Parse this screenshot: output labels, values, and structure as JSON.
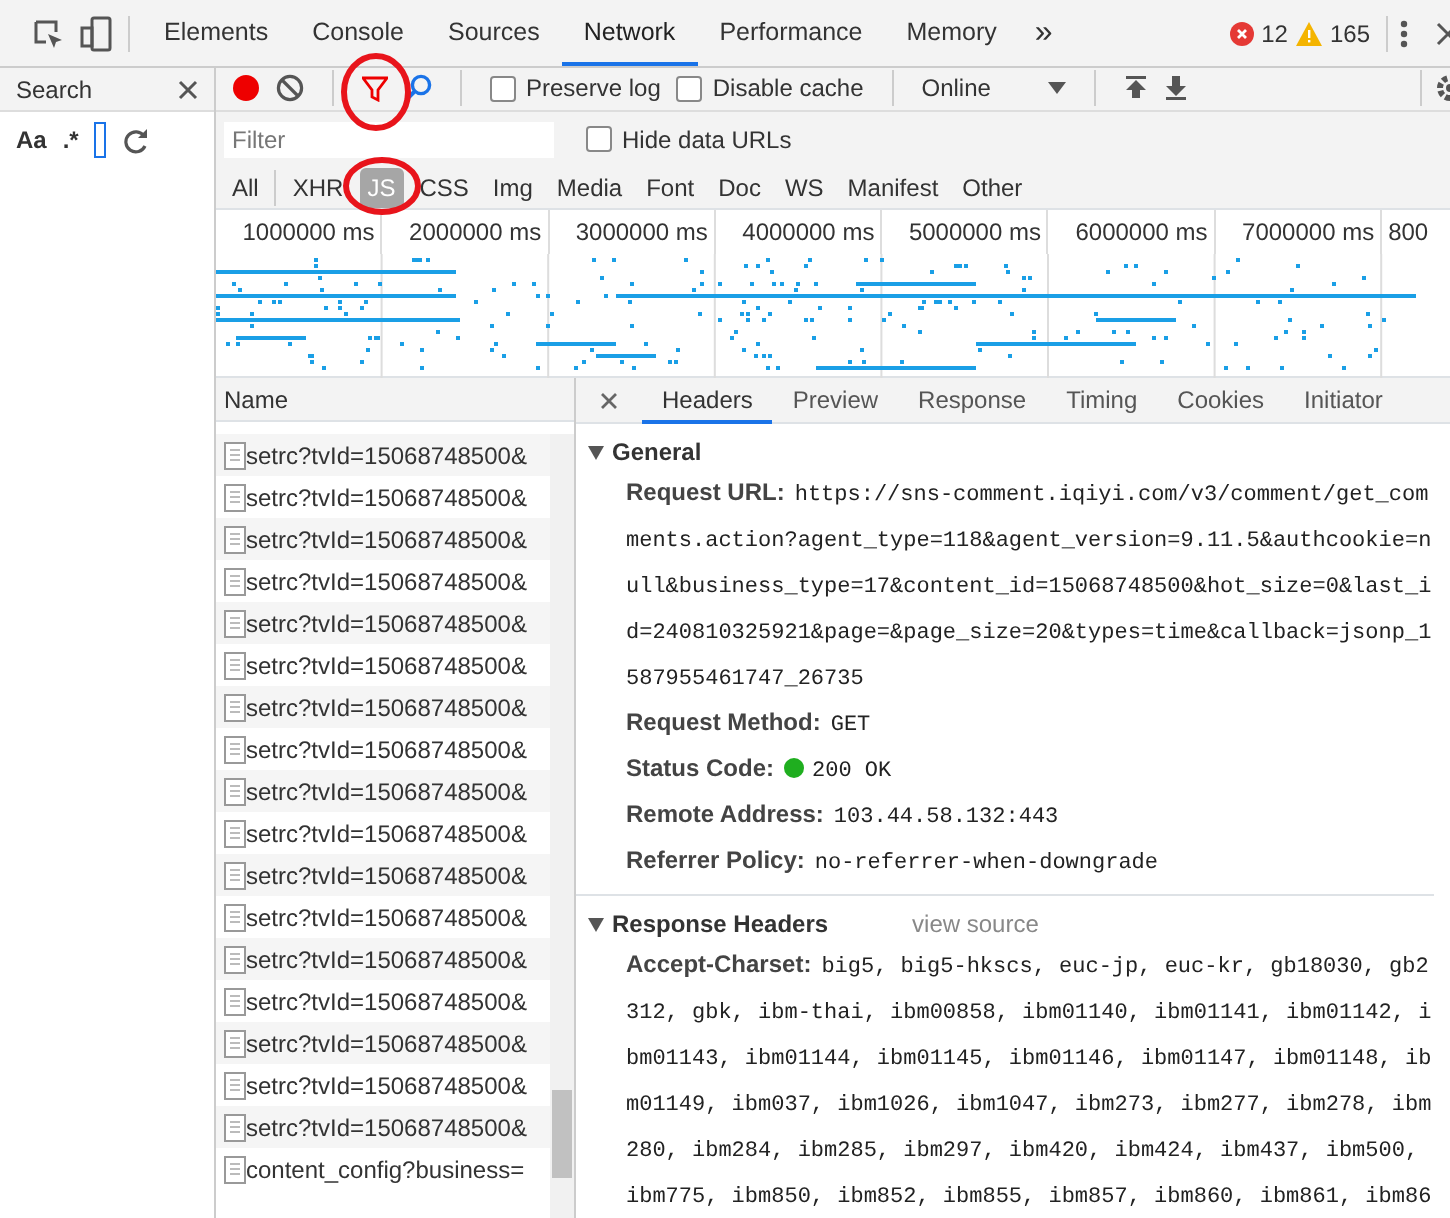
{
  "top_tabs": [
    {
      "label": "Elements",
      "selected": false
    },
    {
      "label": "Console",
      "selected": false
    },
    {
      "label": "Sources",
      "selected": false
    },
    {
      "label": "Network",
      "selected": true
    },
    {
      "label": "Performance",
      "selected": false
    },
    {
      "label": "Memory",
      "selected": false
    }
  ],
  "more_tabs": "»",
  "errors": "12",
  "warnings": "165",
  "search_panel": {
    "title": "Search",
    "case_toggle": "Aa",
    "regex_toggle": ".*"
  },
  "toolbar": {
    "recording": true,
    "filter_circled": true,
    "preserve_log": {
      "label": "Preserve log",
      "checked": false
    },
    "disable_cache": {
      "label": "Disable cache",
      "checked": false
    },
    "throttle": "Online"
  },
  "filter": {
    "placeholder": "Filter",
    "hide_data_urls": {
      "label": "Hide data URLs",
      "checked": false
    }
  },
  "types": [
    {
      "label": "All",
      "selected": false,
      "circled": false
    },
    {
      "label": "XHR",
      "selected": false,
      "circled": false
    },
    {
      "label": "JS",
      "selected": true,
      "circled": true
    },
    {
      "label": "CSS",
      "selected": false,
      "circled": false
    },
    {
      "label": "Img",
      "selected": false,
      "circled": false
    },
    {
      "label": "Media",
      "selected": false,
      "circled": false
    },
    {
      "label": "Font",
      "selected": false,
      "circled": false
    },
    {
      "label": "Doc",
      "selected": false,
      "circled": false
    },
    {
      "label": "WS",
      "selected": false,
      "circled": false
    },
    {
      "label": "Manifest",
      "selected": false,
      "circled": false
    },
    {
      "label": "Other",
      "selected": false,
      "circled": false
    }
  ],
  "timeline": {
    "ticks": [
      "1000000 ms",
      "2000000 ms",
      "3000000 ms",
      "4000000 ms",
      "5000000 ms",
      "6000000 ms",
      "7000000 ms",
      "800"
    ]
  },
  "requests": {
    "column": "Name",
    "rows": [
      {
        "name": "setrc?tvId=15068748500&"
      },
      {
        "name": "setrc?tvId=15068748500&"
      },
      {
        "name": "setrc?tvId=15068748500&"
      },
      {
        "name": "setrc?tvId=15068748500&"
      },
      {
        "name": "setrc?tvId=15068748500&"
      },
      {
        "name": "setrc?tvId=15068748500&"
      },
      {
        "name": "setrc?tvId=15068748500&"
      },
      {
        "name": "setrc?tvId=15068748500&"
      },
      {
        "name": "setrc?tvId=15068748500&"
      },
      {
        "name": "setrc?tvId=15068748500&"
      },
      {
        "name": "setrc?tvId=15068748500&"
      },
      {
        "name": "setrc?tvId=15068748500&"
      },
      {
        "name": "setrc?tvId=15068748500&"
      },
      {
        "name": "setrc?tvId=15068748500&"
      },
      {
        "name": "setrc?tvId=15068748500&"
      },
      {
        "name": "setrc?tvId=15068748500&"
      },
      {
        "name": "setrc?tvId=15068748500&"
      },
      {
        "name": "content_config?business="
      }
    ]
  },
  "details": {
    "tabs": [
      {
        "label": "Headers",
        "selected": true
      },
      {
        "label": "Preview",
        "selected": false
      },
      {
        "label": "Response",
        "selected": false
      },
      {
        "label": "Timing",
        "selected": false
      },
      {
        "label": "Cookies",
        "selected": false
      },
      {
        "label": "Initiator",
        "selected": false
      }
    ],
    "sections": [
      {
        "title": "General",
        "expanded": true,
        "fields": [
          {
            "kind": "text",
            "label": "Request URL:",
            "value": "https://sns-comment.iqiyi.com/v3/comment/get_comments.action?agent_type=118&agent_version=9.11.5&authcookie=null&business_type=17&content_id=15068748500&hot_size=0&last_id=240810325921&page=&page_size=20&types=time&callback=jsonp_1587955461747_26735"
          },
          {
            "kind": "text",
            "label": "Request Method:",
            "value": "GET"
          },
          {
            "kind": "status",
            "label": "Status Code:",
            "value": "200 OK"
          },
          {
            "kind": "text",
            "label": "Remote Address:",
            "value": "103.44.58.132:443"
          },
          {
            "kind": "text",
            "label": "Referrer Policy:",
            "value": "no-referrer-when-downgrade"
          }
        ]
      },
      {
        "title": "Response Headers",
        "expanded": true,
        "link": "view source",
        "fields": [
          {
            "kind": "text",
            "label": "Accept-Charset:",
            "value": "big5, big5-hkscs, euc-jp, euc-kr, gb18030, gb2312, gbk, ibm-thai, ibm00858, ibm01140, ibm01141, ibm01142, ibm01143, ibm01144, ibm01145, ibm01146, ibm01147, ibm01148, ibm01149, ibm037, ibm1026, ibm1047, ibm273, ibm277, ibm278, ibm280, ibm284, ibm285, ibm297, ibm420, ibm424, ibm437, ibm500, ibm775, ibm850, ibm852, ibm855, ibm857, ibm860, ibm861, ibm86"
          }
        ]
      }
    ]
  }
}
